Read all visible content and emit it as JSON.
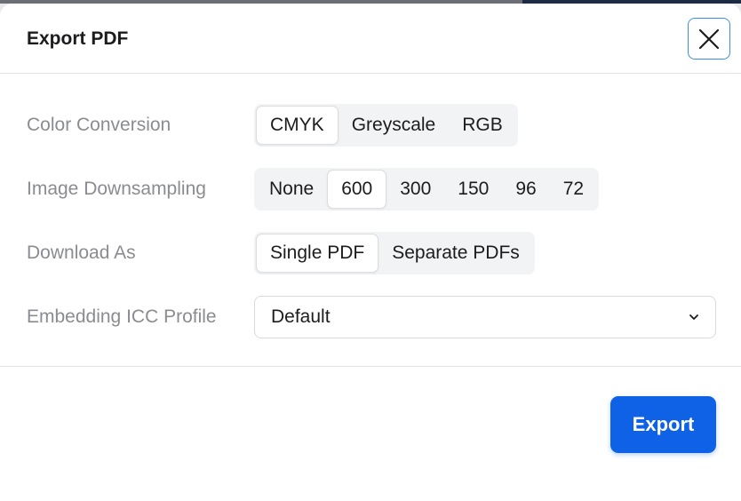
{
  "dialog": {
    "title": "Export PDF",
    "close_icon": "close-icon",
    "accent": "#0f62e6"
  },
  "color_conversion": {
    "label": "Color Conversion",
    "options": [
      "CMYK",
      "Greyscale",
      "RGB"
    ],
    "selected": "CMYK"
  },
  "image_downsampling": {
    "label": "Image Downsampling",
    "options": [
      "None",
      "600",
      "300",
      "150",
      "96",
      "72"
    ],
    "selected": "600"
  },
  "download_as": {
    "label": "Download As",
    "options": [
      "Single PDF",
      "Separate PDFs"
    ],
    "selected": "Single PDF"
  },
  "icc_profile": {
    "label": "Embedding ICC Profile",
    "value": "Default",
    "icon": "chevron-down-icon"
  },
  "footer": {
    "export_label": "Export"
  }
}
